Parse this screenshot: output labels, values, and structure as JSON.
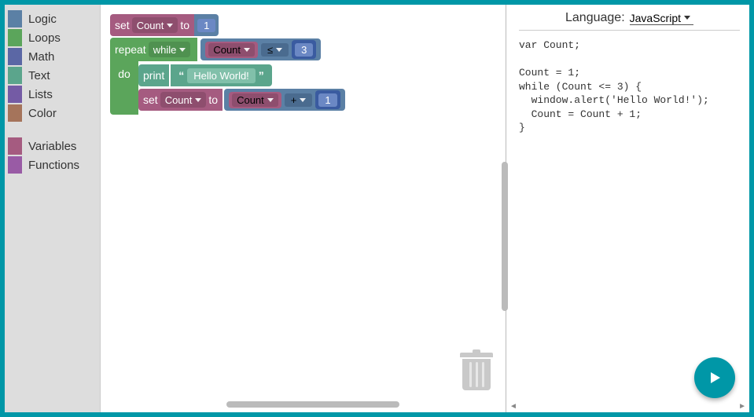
{
  "toolbox": {
    "items": [
      {
        "label": "Logic",
        "color": "#5b80a5"
      },
      {
        "label": "Loops",
        "color": "#5ba55b"
      },
      {
        "label": "Math",
        "color": "#5b67a5"
      },
      {
        "label": "Text",
        "color": "#5ba58c"
      },
      {
        "label": "Lists",
        "color": "#745ba5"
      },
      {
        "label": "Color",
        "color": "#a5745b"
      }
    ],
    "items2": [
      {
        "label": "Variables",
        "color": "#a55b80"
      },
      {
        "label": "Functions",
        "color": "#995ba5"
      }
    ]
  },
  "blocks": {
    "set1": {
      "set": "set",
      "var": "Count",
      "to": "to",
      "value": "1"
    },
    "repeat": {
      "repeat": "repeat",
      "while": "while",
      "do": "do",
      "cond": {
        "var": "Count",
        "op": "≤",
        "val": "3"
      }
    },
    "print": {
      "print": "print",
      "text": "Hello World!"
    },
    "set2": {
      "set": "set",
      "var": "Count",
      "to": "to",
      "expr": {
        "var": "Count",
        "op": "+",
        "val": "1"
      }
    }
  },
  "codepanel": {
    "lang_label": "Language:",
    "lang_value": "JavaScript",
    "code": "var Count;\n\nCount = 1;\nwhile (Count <= 3) {\n  window.alert('Hello World!');\n  Count = Count + 1;\n}"
  }
}
